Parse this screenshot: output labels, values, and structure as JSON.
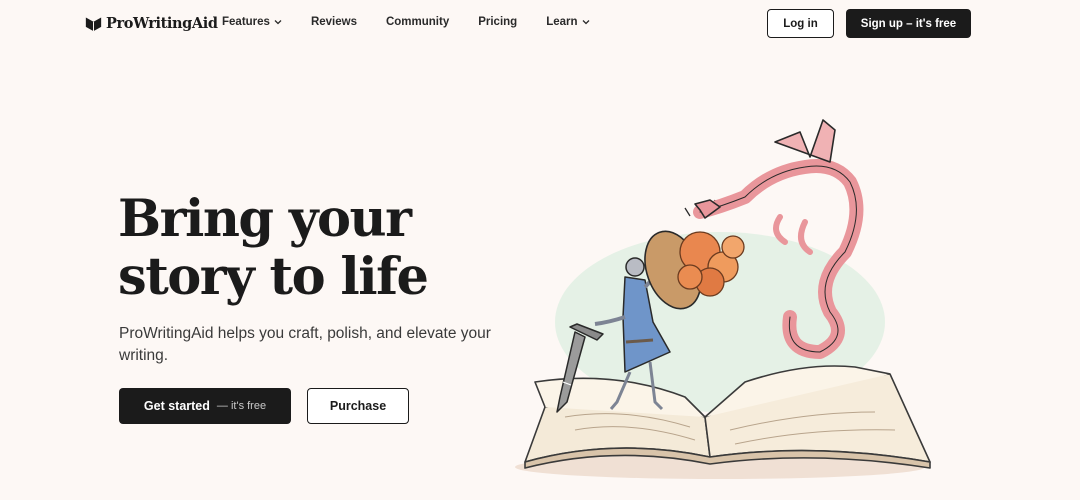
{
  "brand": {
    "name": "ProWritingAid",
    "icon": "open-book-heart-icon",
    "primary_color": "#1b1b1b",
    "background_color": "#fdf8f5"
  },
  "nav": {
    "items": [
      {
        "label": "Features",
        "has_dropdown": true
      },
      {
        "label": "Reviews",
        "has_dropdown": false
      },
      {
        "label": "Community",
        "has_dropdown": false
      },
      {
        "label": "Pricing",
        "has_dropdown": false
      },
      {
        "label": "Learn",
        "has_dropdown": true
      }
    ],
    "login_label": "Log in",
    "signup_label": "Sign up – it's free"
  },
  "hero": {
    "title_line1": "Bring your",
    "title_line2": "story to life",
    "subtitle": "ProWritingAid helps you craft, polish, and elevate your writing.",
    "primary_cta": "Get started",
    "primary_cta_suffix": "— it's free",
    "secondary_cta": "Purchase",
    "illustration": "knight-fighting-dragon-over-open-book"
  }
}
